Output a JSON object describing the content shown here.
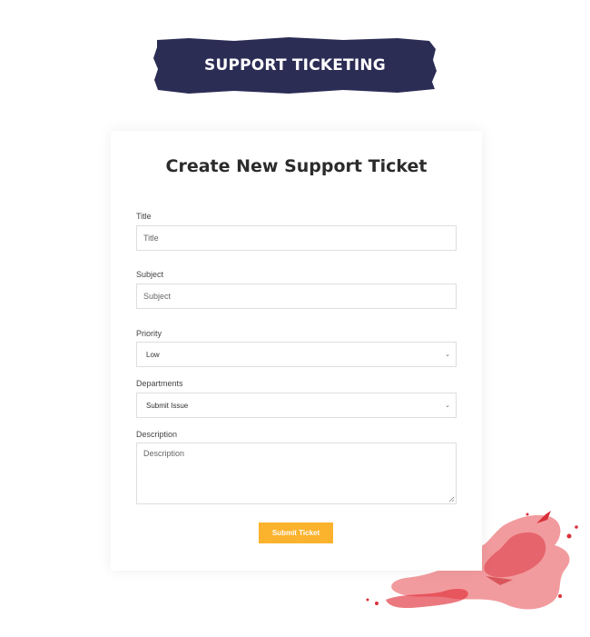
{
  "banner": {
    "title": "SUPPORT TICKETING",
    "color": "#2c2d55"
  },
  "form": {
    "heading": "Create New Support Ticket",
    "title_field": {
      "label": "Title",
      "placeholder": "Title"
    },
    "subject_field": {
      "label": "Subject",
      "placeholder": "Subject"
    },
    "priority_field": {
      "label": "Priority",
      "value": "Low"
    },
    "departments_field": {
      "label": "Departments",
      "value": "Submit Issue"
    },
    "description_field": {
      "label": "Description",
      "placeholder": "Description"
    },
    "submit_label": "Submit Ticket",
    "accent_color": "#fbb22c"
  },
  "icons": {
    "select_chevron": "chevron-down-icon",
    "resize": "resize-handle-icon",
    "splash": "paint-splash"
  }
}
